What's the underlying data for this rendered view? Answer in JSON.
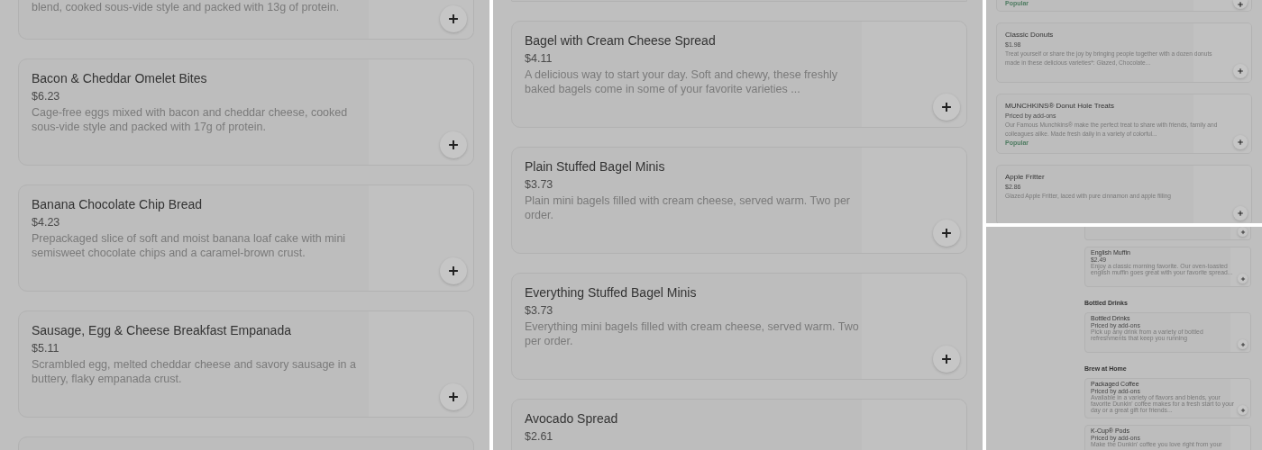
{
  "panels": [
    {
      "kind": "large",
      "items": [
        {
          "kind": "tail",
          "description": "blend, cooked sous-vide style and packed with 13g of protein."
        },
        {
          "kind": "card",
          "title": "Bacon & Cheddar Omelet Bites",
          "price": "$6.23",
          "description": "Cage-free eggs mixed with bacon and cheddar cheese, cooked sous-vide style and packed with 17g of protein."
        },
        {
          "kind": "card",
          "title": "Banana Chocolate Chip Bread",
          "price": "$4.23",
          "description": "Prepackaged slice of soft and moist banana loaf cake with mini semisweet chocolate chips and a caramel-brown crust."
        },
        {
          "kind": "card",
          "title": "Sausage, Egg & Cheese Breakfast Empanada",
          "price": "$5.11",
          "description": "Scrambled egg, melted cheddar cheese and savory sausage in a buttery, flaky empanada crust."
        },
        {
          "kind": "stub"
        }
      ]
    },
    {
      "kind": "large",
      "items": [
        {
          "kind": "edge"
        },
        {
          "kind": "card",
          "title": "Bagel with Cream Cheese Spread",
          "price": "$4.11",
          "description": "A delicious way to start your day. Soft and chewy, these freshly baked bagels come in some of your favorite varieties ..."
        },
        {
          "kind": "card",
          "title": "Plain Stuffed Bagel Minis",
          "price": "$3.73",
          "description": "Plain mini bagels filled with cream cheese, served warm. Two per order."
        },
        {
          "kind": "card",
          "title": "Everything Stuffed Bagel Minis",
          "price": "$3.73",
          "description": "Everything mini bagels filled with cream cheese, served warm. Two per order."
        },
        {
          "kind": "cut",
          "title": "Avocado Spread",
          "price": "$2.61"
        }
      ]
    },
    {
      "kind": "small",
      "items": [
        {
          "kind": "tail",
          "badge": "Popular"
        },
        {
          "kind": "card",
          "title": "Classic Donuts",
          "price": "$1.98",
          "description": "Treat yourself or share the joy by bringing people together with a dozen donuts made in these delicious varieties*: Glazed, Chocolate..."
        },
        {
          "kind": "card",
          "title": "MUNCHKINS® Donut Hole Treats",
          "price": "Priced by add-ons",
          "description": "Our Famous Munchkins® make the perfect treat to share with friends, family and colleagues alike. Made fresh daily in a variety of colorful...",
          "badge": "Popular"
        },
        {
          "kind": "card",
          "title": "Apple Fritter",
          "price": "$2.86",
          "description": "Glazed Apple Fritter, laced with pure cinnamon and apple filling"
        }
      ]
    },
    {
      "kind": "tiny",
      "items": [
        {
          "kind": "tail"
        },
        {
          "kind": "card",
          "title": "English Muffin",
          "price": "$2.49",
          "description": "Enjoy a classic morning favorite. Our oven-toasted english muffin goes great with your favorite spread..."
        },
        {
          "kind": "heading",
          "title": "Bottled Drinks"
        },
        {
          "kind": "card",
          "title": "Bottled Drinks",
          "price": "Priced by add-ons",
          "description": "Pick up any drink from a variety of bottled refreshments that keep you running"
        },
        {
          "kind": "heading",
          "title": "Brew at Home"
        },
        {
          "kind": "card",
          "title": "Packaged Coffee",
          "price": "Priced by add-ons",
          "description": "Available in a variety of flavors and blends, your favorite Dunkin' coffee makes for a fresh start to your day or a great gift for friends..."
        },
        {
          "kind": "cut",
          "title": "K-Cup® Pods",
          "price": "Priced by add-ons",
          "description": "Make the Dunkin' coffee you love right from your"
        }
      ]
    }
  ]
}
